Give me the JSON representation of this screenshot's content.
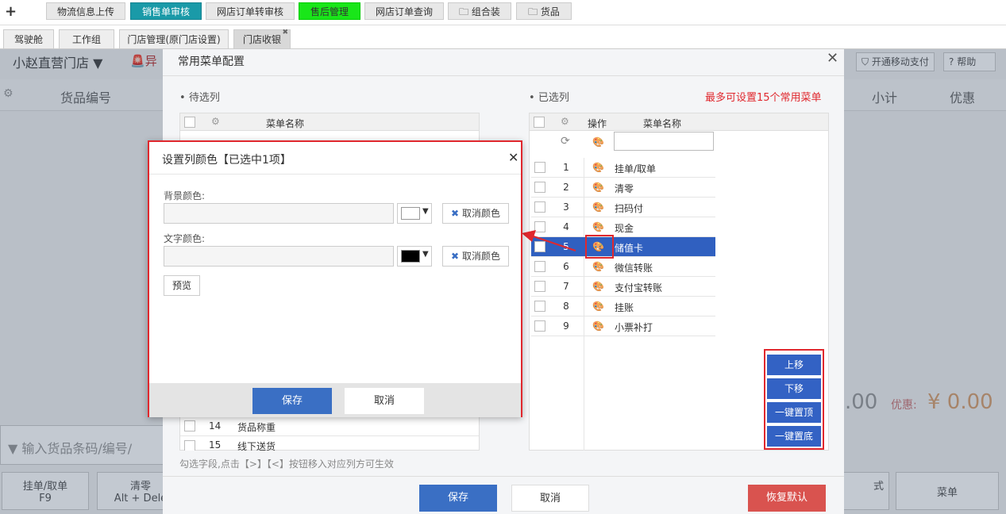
{
  "topbar": {
    "plus": "+",
    "tabs": [
      "物流信息上传",
      "销售单审核",
      "网店订单转审核",
      "售后管理",
      "网店订单查询",
      "组合装",
      "货品"
    ]
  },
  "subtabs": [
    "驾驶舱",
    "工作组",
    "门店管理(原门店设置)",
    "门店收银"
  ],
  "page": {
    "store": "小赵直营门店",
    "alert": "异",
    "col_code": "货品编号",
    "col_subtotal": "小计",
    "col_discount": "优惠",
    "pay_button": "开通移动支付",
    "help_button": "帮助",
    "amount_total": ".00",
    "discount_label": "优惠:",
    "discount_value": "¥ 0.00",
    "barcode_placeholder": "输入货品条码/编号/",
    "btn_hang": "挂单/取单",
    "btn_hang_key": "F9",
    "btn_clear": "清零",
    "btn_clear_key": "Alt + Dele",
    "btn_style": "式",
    "btn_menu": "菜单"
  },
  "config": {
    "title": "常用菜单配置",
    "left_section": "待选列",
    "right_section": "已选列",
    "limit_note": "最多可设置15个常用菜单",
    "col_op": "操作",
    "col_name": "菜单名称",
    "left_rows": [
      {
        "n": "14",
        "name": "货品称重"
      },
      {
        "n": "15",
        "name": "线下送货"
      }
    ],
    "right_rows": [
      {
        "n": "1",
        "name": "挂单/取单"
      },
      {
        "n": "2",
        "name": "清零"
      },
      {
        "n": "3",
        "name": "扫码付"
      },
      {
        "n": "4",
        "name": "现金"
      },
      {
        "n": "5",
        "name": "储值卡"
      },
      {
        "n": "6",
        "name": "微信转账"
      },
      {
        "n": "7",
        "name": "支付宝转账"
      },
      {
        "n": "8",
        "name": "挂账"
      },
      {
        "n": "9",
        "name": "小票补打"
      }
    ],
    "move_up": "上移",
    "move_down": "下移",
    "to_top": "一键置顶",
    "to_bottom": "一键置底",
    "hint": "勾选字段,点击【>】【<】按钮移入对应列方可生效",
    "save": "保存",
    "cancel": "取消",
    "restore": "恢复默认"
  },
  "color_dialog": {
    "title": "设置列颜色【已选中1项】",
    "bg_label": "背景颜色:",
    "text_label": "文字颜色:",
    "clear_color": "取消颜色",
    "preview": "预览",
    "save": "保存",
    "cancel": "取消",
    "bg_swatch": "#ffffff",
    "text_swatch": "#000000"
  },
  "colors": {
    "accent_blue": "#3362c4",
    "highlight_red": "#e0282e",
    "teal_tab": "#1a9aa8",
    "green_tab": "#19e619"
  }
}
